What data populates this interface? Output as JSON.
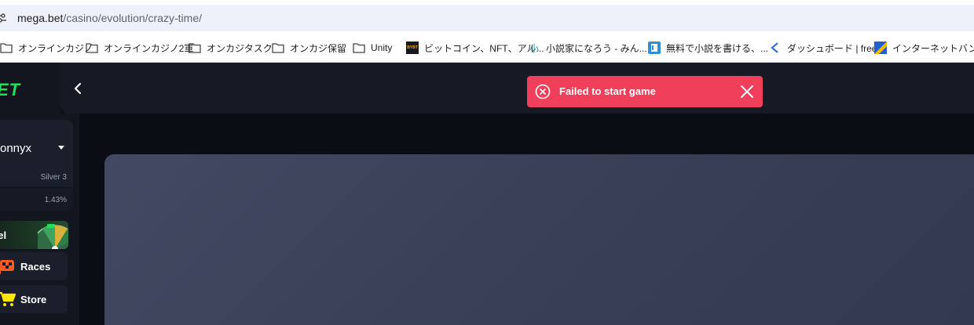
{
  "browser": {
    "url_host": "mega.bet",
    "url_path": "/casino/evolution/crazy-time/"
  },
  "bookmarks": [
    {
      "label": "オンラインカジノ",
      "icon": "folder-icon"
    },
    {
      "label": "オンラインカジノ2軍",
      "icon": "folder-icon"
    },
    {
      "label": "オンカジタスク",
      "icon": "folder-icon"
    },
    {
      "label": "オンカジ保留",
      "icon": "folder-icon"
    },
    {
      "label": "Unity",
      "icon": "folder-icon"
    },
    {
      "label": "ビットコイン、NFT、アル...",
      "icon": "site-favicon",
      "favicon_text": "BYBT"
    },
    {
      "label": "小説家になろう - みん...",
      "icon": "site-favicon",
      "favicon_text": "小"
    },
    {
      "label": "無料で小説を書ける、...",
      "icon": "site-favicon"
    },
    {
      "label": "ダッシュボード | freee",
      "icon": "site-favicon"
    },
    {
      "label": "インターネットバンキング",
      "icon": "site-favicon"
    }
  ],
  "app": {
    "logo_text": "ET",
    "toast": {
      "message": "Failed to start game"
    },
    "user": {
      "name": "onnyx",
      "rank": "Silver 3",
      "progress_label": "1.43%",
      "progress_value": 1.43
    },
    "nav": {
      "wheel_label": "eel",
      "races_label": "Races",
      "store_label": "Store"
    },
    "colors": {
      "brand_green": "#1fe05a",
      "toast_red": "#ef3f5a",
      "panel": "#13161f"
    }
  }
}
